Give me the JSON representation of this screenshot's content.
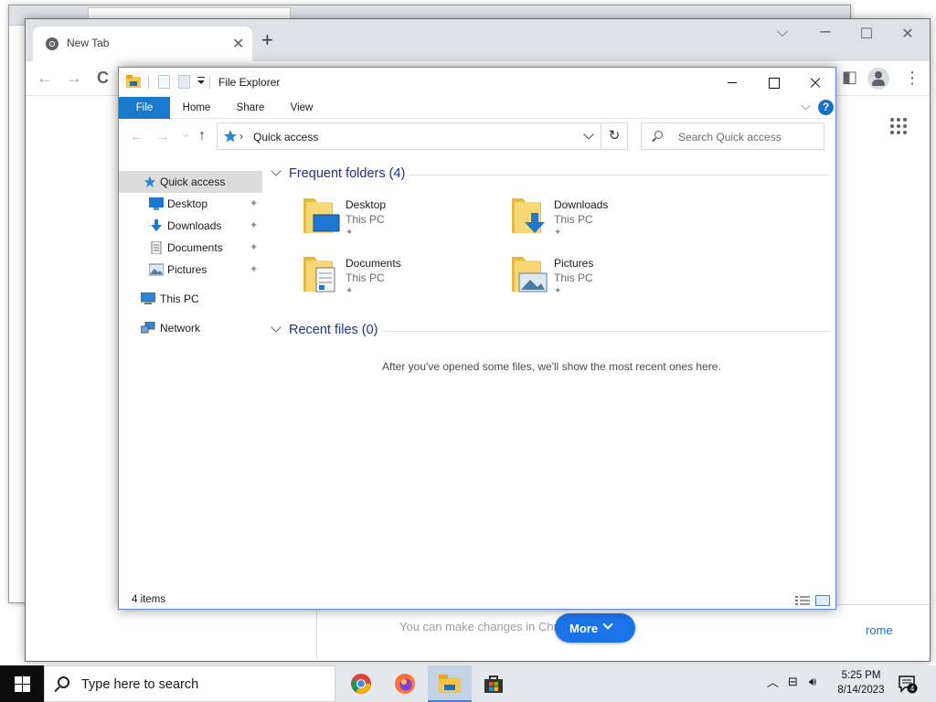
{
  "browser": {
    "tab_title": "New Tab",
    "tab_close": "✕",
    "new_tab": "+",
    "minimize": "⌵",
    "maximize": "☐",
    "close": "✕",
    "back": "←",
    "forward": "→",
    "reload": "C",
    "menu": "⋮",
    "page_text": "You can make changes in Chr",
    "page_link": "rome",
    "more_button": "More"
  },
  "explorer": {
    "title": "File Explorer",
    "ribbon_tabs": [
      "File",
      "Home",
      "Share",
      "View"
    ],
    "help": "?",
    "nav_back": "←",
    "nav_forward": "→",
    "nav_recent": "⌄",
    "nav_up": "↑",
    "address_sep": "›",
    "address": "Quick access",
    "refresh": "↻",
    "search_placeholder": "Search Quick access",
    "sidebar": [
      {
        "label": "Quick access",
        "pinned": false
      },
      {
        "label": "Desktop",
        "pinned": true
      },
      {
        "label": "Downloads",
        "pinned": true
      },
      {
        "label": "Documents",
        "pinned": true
      },
      {
        "label": "Pictures",
        "pinned": true
      },
      {
        "label": "This PC",
        "pinned": false
      },
      {
        "label": "Network",
        "pinned": false
      }
    ],
    "pin_glyph": "📌",
    "frequent_header": "Frequent folders (4)",
    "folders": [
      {
        "name": "Desktop",
        "location": "This PC"
      },
      {
        "name": "Downloads",
        "location": "This PC"
      },
      {
        "name": "Documents",
        "location": "This PC"
      },
      {
        "name": "Pictures",
        "location": "This PC"
      }
    ],
    "recent_header": "Recent files (0)",
    "recent_empty": "After you've opened some files, we'll show the most recent ones here.",
    "status_items": "4 items"
  },
  "taskbar": {
    "search_placeholder": "Type here to search",
    "time": "5:25 PM",
    "date": "8/14/2023",
    "notification_count": "4",
    "tray_up": "︿",
    "accent": "#1a73e8"
  }
}
